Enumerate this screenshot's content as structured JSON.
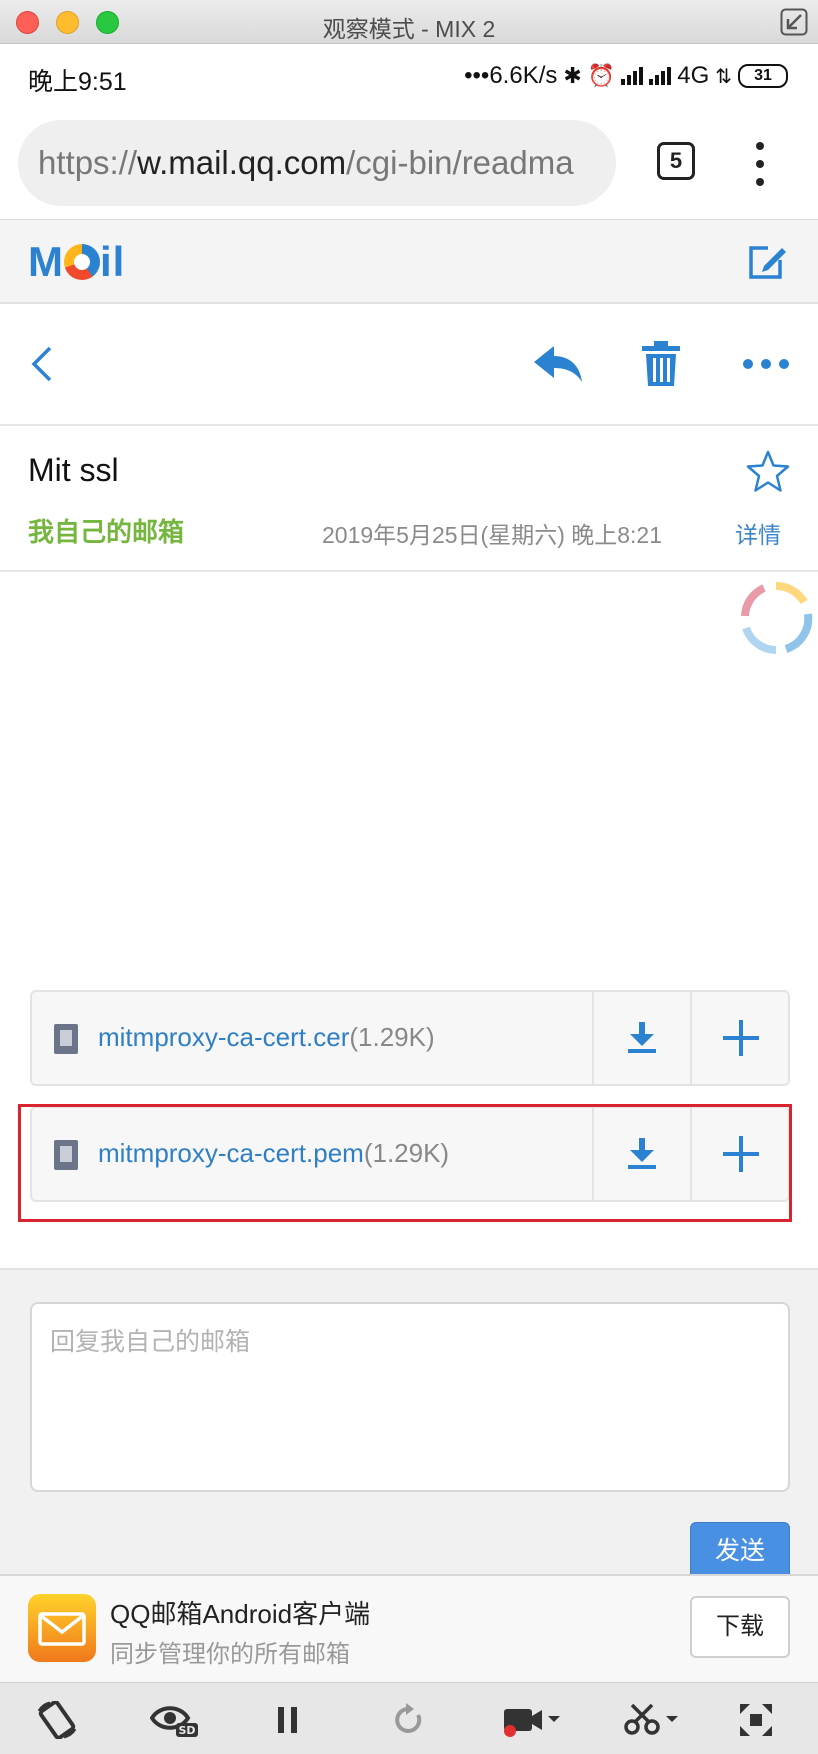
{
  "window": {
    "title": "观察模式 - MIX 2"
  },
  "status_bar": {
    "time": "晚上9:51",
    "net_speed": "•••6.6K/s",
    "network": "4G",
    "battery": "31"
  },
  "browser": {
    "url_prefix": "https://",
    "url_host": "w.mail.qq.com",
    "url_path": "/cgi-bin/readma",
    "tab_count": "5"
  },
  "mail": {
    "logo": {
      "m": "M",
      "rest": "il"
    },
    "subject": "Mit ssl",
    "sender": "我自己的邮箱",
    "date": "2019年5月25日(星期六) 晚上8:21",
    "details_link": "详情",
    "attachments": [
      {
        "filename": "mitmproxy-ca-cert.cer",
        "size": "(1.29K)"
      },
      {
        "filename": "mitmproxy-ca-cert.pem",
        "size": "(1.29K)"
      }
    ],
    "reply_placeholder": "回复我自己的邮箱",
    "send_label": "发送"
  },
  "promo": {
    "title": "QQ邮箱Android客户端",
    "subtitle": "同步管理你的所有邮箱",
    "download_label": "下载"
  },
  "colors": {
    "accent": "#2b82d1",
    "sender_green": "#74b63e",
    "highlight_red": "#d9232e",
    "send_blue": "#4a90e2"
  }
}
